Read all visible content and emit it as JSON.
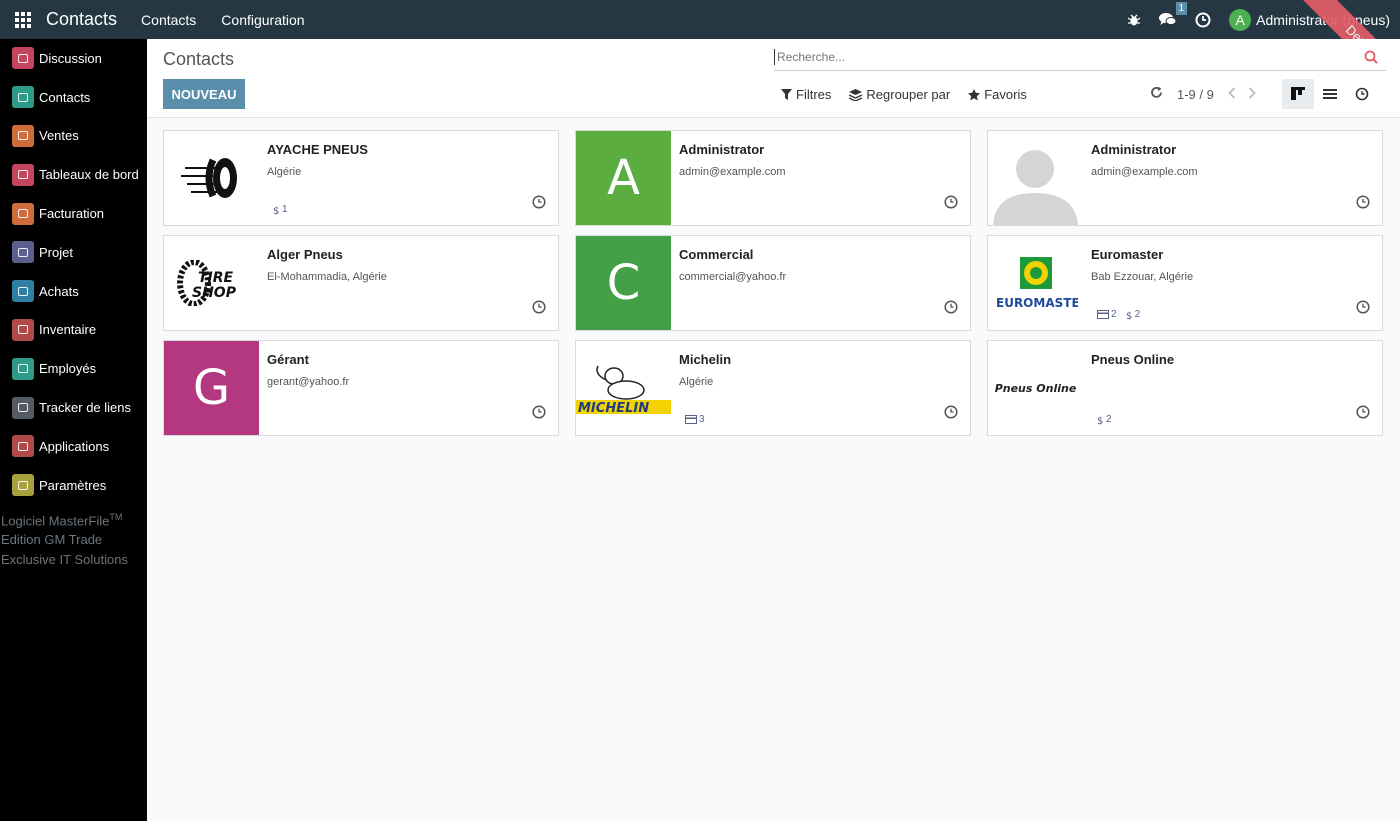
{
  "topbar": {
    "app_title": "Contacts",
    "menu": [
      "Contacts",
      "Configuration"
    ],
    "chat_count": "1",
    "user_initial": "A",
    "user_name": "Administrator (pneus)",
    "ribbon": "Demo",
    "colors": {
      "bar": "#243742",
      "avatar": "#4caf50",
      "badge": "#5a8fab",
      "ribbon": "#e35d6a"
    }
  },
  "sidebar": {
    "items": [
      {
        "label": "Discussion",
        "icon": "discussion-icon",
        "color": "#c3465e"
      },
      {
        "label": "Contacts",
        "icon": "contacts-icon",
        "color": "#2d9b8a"
      },
      {
        "label": "Ventes",
        "icon": "sales-icon",
        "color": "#d06b3c"
      },
      {
        "label": "Tableaux de bord",
        "icon": "dashboard-icon",
        "color": "#c3465e"
      },
      {
        "label": "Facturation",
        "icon": "invoicing-icon",
        "color": "#d06b3c"
      },
      {
        "label": "Projet",
        "icon": "project-icon",
        "color": "#5b5f8e"
      },
      {
        "label": "Achats",
        "icon": "purchase-icon",
        "color": "#2f7fa5"
      },
      {
        "label": "Inventaire",
        "icon": "inventory-icon",
        "color": "#b04a4a"
      },
      {
        "label": "Employés",
        "icon": "employees-icon",
        "color": "#2d9b8a"
      },
      {
        "label": "Tracker de liens",
        "icon": "link-tracker-icon",
        "color": "#555b63"
      },
      {
        "label": "Applications",
        "icon": "apps-icon",
        "color": "#b04a4a"
      },
      {
        "label": "Paramètres",
        "icon": "settings-icon",
        "color": "#a8a03c"
      }
    ],
    "footer": {
      "line1": "Logiciel MasterFile",
      "tm": "TM",
      "line2": "Edition GM Trade",
      "line3": "Exclusive IT Solutions"
    }
  },
  "control": {
    "title": "Contacts",
    "new_button": "NOUVEAU",
    "search_placeholder": "Recherche...",
    "filters": "Filtres",
    "group_by": "Regrouper par",
    "favorites": "Favoris",
    "pager": "1-9 / 9"
  },
  "cards": [
    {
      "name": "AYACHE PNEUS",
      "sub": "Algérie",
      "tags": [
        {
          "type": "dollar",
          "count": "1"
        }
      ],
      "image": "tire-logo",
      "letter": "",
      "color": ""
    },
    {
      "name": "Administrator",
      "sub": "admin@example.com",
      "tags": [],
      "image": "letter",
      "letter": "A",
      "color": "#5cad3f"
    },
    {
      "name": "Administrator",
      "sub": "admin@example.com",
      "tags": [],
      "image": "placeholder-avatar",
      "letter": "",
      "color": ""
    },
    {
      "name": "Alger Pneus",
      "sub": "El-Mohammadia, Algérie",
      "tags": [],
      "image": "tire-shop-logo",
      "letter": "",
      "color": ""
    },
    {
      "name": "Commercial",
      "sub": "commercial@yahoo.fr",
      "tags": [],
      "image": "letter",
      "letter": "C",
      "color": "#43a047"
    },
    {
      "name": "Euromaster",
      "sub": "Bab Ezzouar, Algérie",
      "tags": [
        {
          "type": "card",
          "count": "2"
        },
        {
          "type": "dollar",
          "count": "2"
        }
      ],
      "image": "euromaster-logo",
      "letter": "",
      "color": ""
    },
    {
      "name": "Gérant",
      "sub": "gerant@yahoo.fr",
      "tags": [],
      "image": "letter",
      "letter": "G",
      "color": "#b3387f"
    },
    {
      "name": "Michelin",
      "sub": "Algérie",
      "tags": [
        {
          "type": "card",
          "count": "3"
        }
      ],
      "image": "michelin-logo",
      "letter": "",
      "color": ""
    },
    {
      "name": "Pneus Online",
      "sub": "",
      "tags": [
        {
          "type": "dollar",
          "count": "2"
        }
      ],
      "image": "pneus-online-logo",
      "letter": "",
      "color": "",
      "logo_text": "Pneus Online"
    }
  ]
}
